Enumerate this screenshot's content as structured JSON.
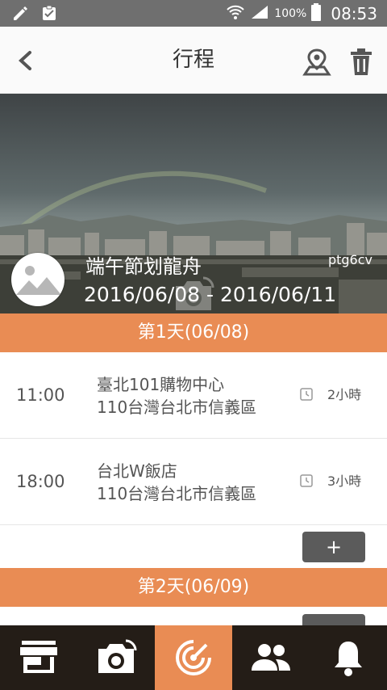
{
  "status_bar": {
    "battery_percent": "100%",
    "time": "08:53"
  },
  "app_bar": {
    "title": "行程"
  },
  "trip": {
    "name": "端午節划龍舟",
    "dates": "2016/06/08 - 2016/06/11",
    "user": "ptg6cv"
  },
  "days": [
    {
      "header": "第1天(06/08)",
      "items": [
        {
          "time": "11:00",
          "name": "臺北101購物中心",
          "address": "110台灣台北市信義區",
          "duration": "2小時"
        },
        {
          "time": "18:00",
          "name": "台北W飯店",
          "address": "110台灣台北市信義區",
          "duration": "3小時"
        }
      ],
      "add_label": "+"
    },
    {
      "header": "第2天(06/09)"
    }
  ],
  "colors": {
    "accent": "#e98c54",
    "tab_bar": "#241d17",
    "status_bar": "#6f6f6f",
    "add_button": "#5b5b5b"
  },
  "tabs": [
    {
      "icon": "store-icon",
      "active": false
    },
    {
      "icon": "camera-icon",
      "active": false
    },
    {
      "icon": "radar-icon",
      "active": true
    },
    {
      "icon": "people-icon",
      "active": false
    },
    {
      "icon": "bell-icon",
      "active": false
    }
  ]
}
